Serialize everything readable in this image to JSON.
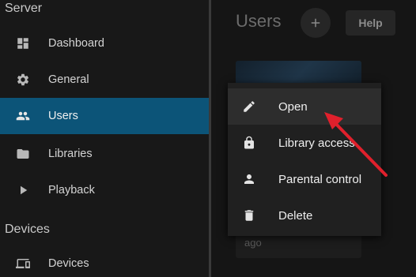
{
  "sidebar": {
    "sections": {
      "server": "Server",
      "devices": "Devices"
    },
    "items": [
      {
        "label": "Dashboard",
        "icon": "dashboard-icon"
      },
      {
        "label": "General",
        "icon": "gear-icon"
      },
      {
        "label": "Users",
        "icon": "users-icon",
        "active": true
      },
      {
        "label": "Libraries",
        "icon": "folder-icon"
      },
      {
        "label": "Playback",
        "icon": "play-icon"
      },
      {
        "label": "Devices",
        "icon": "devices-icon"
      }
    ]
  },
  "main": {
    "title": "Users",
    "add_icon": "plus-icon",
    "help_label": "Help",
    "user_card": {
      "last_seen": "ago"
    }
  },
  "context_menu": {
    "items": [
      {
        "label": "Open",
        "icon": "pencil-icon"
      },
      {
        "label": "Library access",
        "icon": "lock-icon"
      },
      {
        "label": "Parental control",
        "icon": "person-icon"
      },
      {
        "label": "Delete",
        "icon": "trash-icon"
      }
    ]
  },
  "colors": {
    "accent": "#0c5478",
    "annotation_arrow": "#e0202c"
  }
}
